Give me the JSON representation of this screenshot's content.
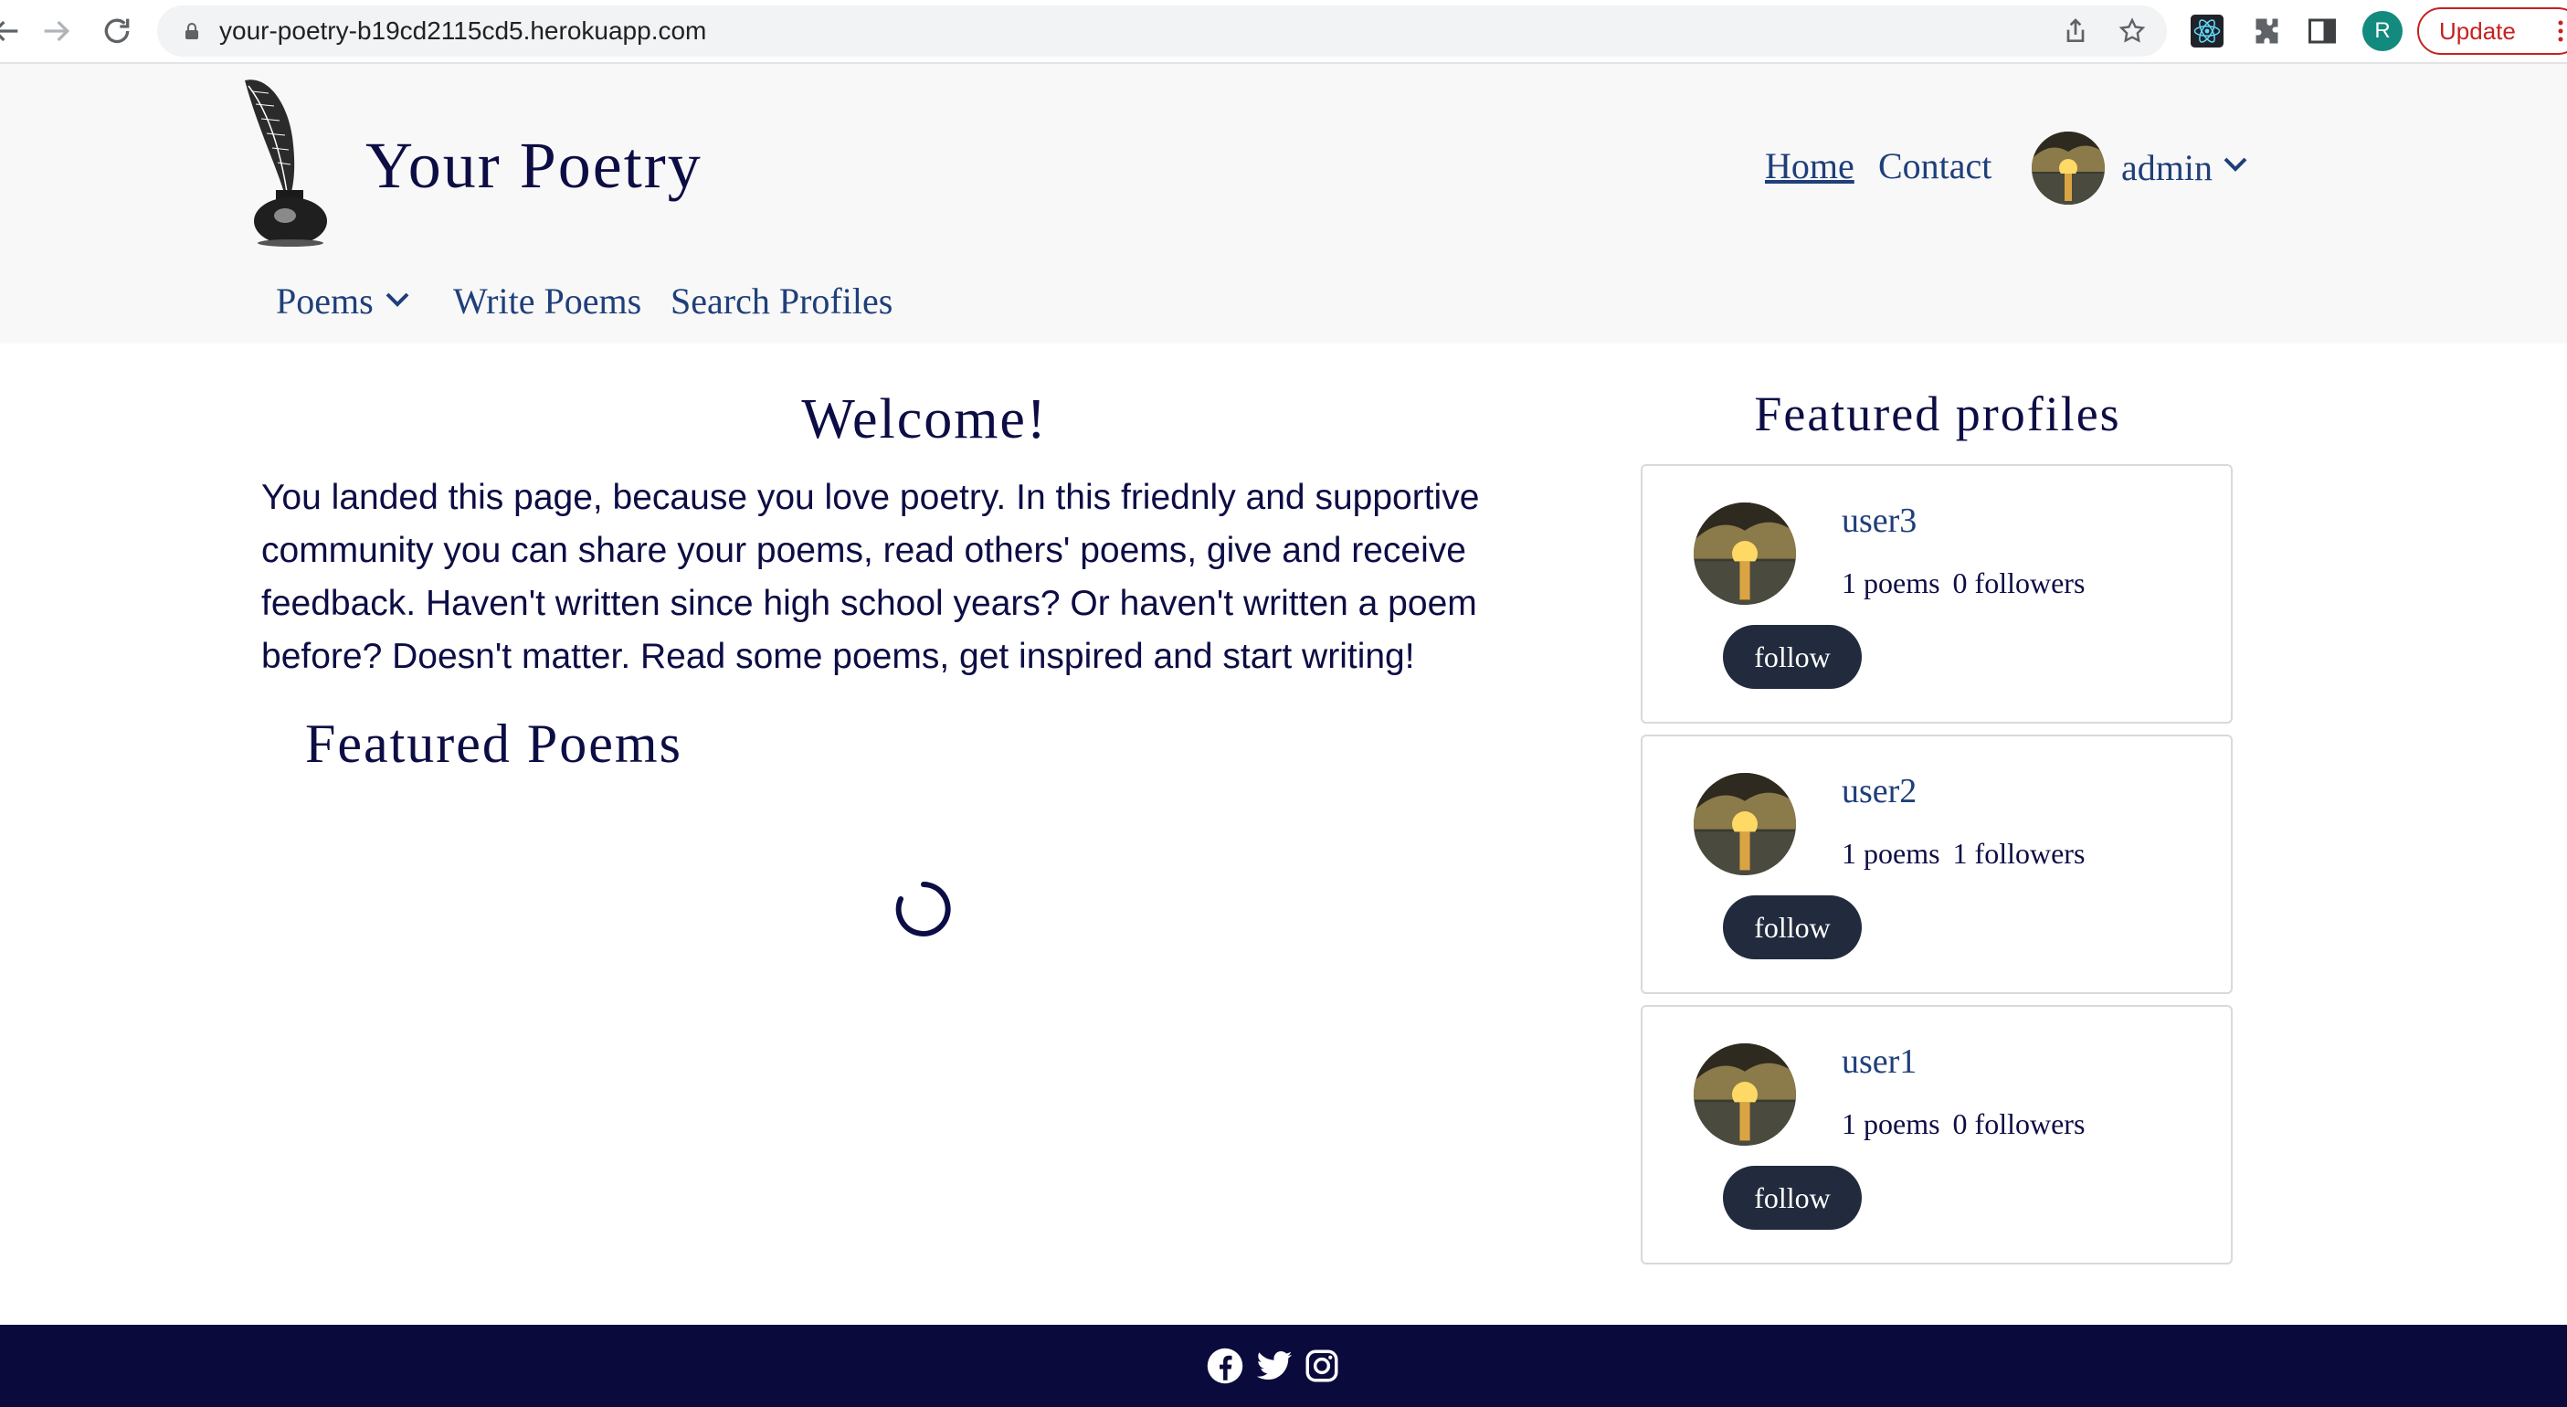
{
  "browser": {
    "url": "your-poetry-b19cd2115cd5.herokuapp.com",
    "profile_initial": "R",
    "update_label": "Update"
  },
  "header": {
    "brand": "Your Poetry",
    "nav": {
      "home": "Home",
      "contact": "Contact"
    },
    "user": {
      "name": "admin"
    },
    "subnav": {
      "poems": "Poems",
      "write": "Write Poems",
      "search": "Search Profiles"
    }
  },
  "main": {
    "welcome_title": "Welcome!",
    "intro": "You landed this page, because you love poetry. In this friednly and supportive community you can share your poems, read others' poems, give and receive feedback. Haven't written since high school years? Or haven't written a poem before? Doesn't matter. Read some poems, get inspired and start writing!",
    "featured_poems_title": "Featured Poems"
  },
  "featured_profiles": {
    "title": "Featured profiles",
    "profiles": [
      {
        "name": "user3",
        "poems": "1 poems",
        "followers": "0 followers",
        "button": "follow"
      },
      {
        "name": "user2",
        "poems": "1 poems",
        "followers": "1 followers",
        "button": "follow"
      },
      {
        "name": "user1",
        "poems": "1 poems",
        "followers": "0 followers",
        "button": "follow"
      }
    ]
  },
  "icons": {
    "footer": [
      "facebook-icon",
      "twitter-icon",
      "instagram-icon"
    ]
  },
  "colors": {
    "brand_navy": "#0d0d45",
    "link_blue": "#1f3f7a",
    "button_dark": "#222b3d",
    "footer_bg": "#0b0a3c"
  }
}
